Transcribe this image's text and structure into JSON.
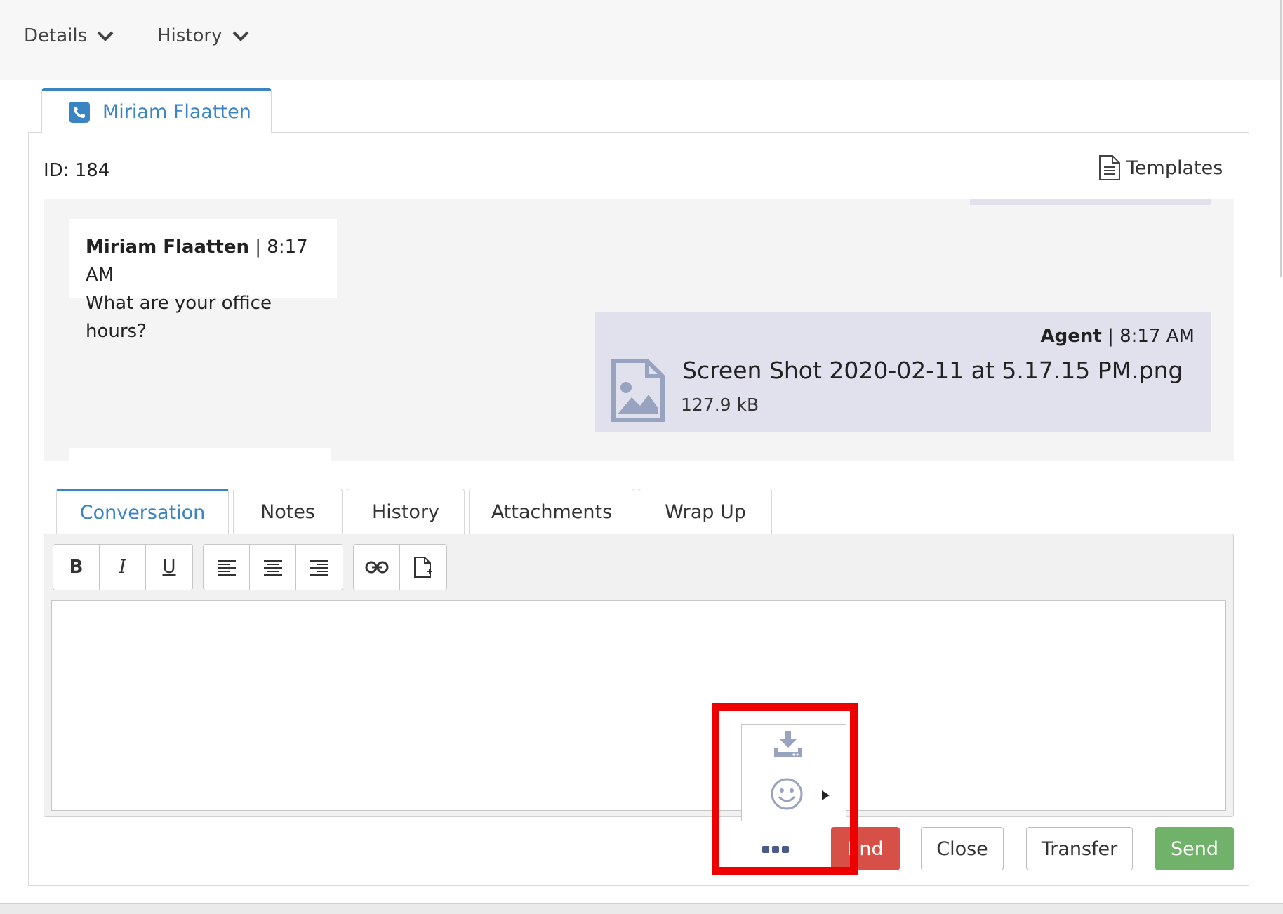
{
  "top_nav": {
    "details_label": "Details",
    "history_label": "History"
  },
  "conversation_tab": {
    "name": "Miriam Flaatten",
    "icon": "phone-icon"
  },
  "panel": {
    "id_label": "ID: 184",
    "templates_label": "Templates"
  },
  "messages": [
    {
      "sender": "Miriam Flaatten",
      "separator": "|",
      "time": "8:17 AM",
      "text": "What are your office hours?"
    },
    {
      "sender": "Agent",
      "separator": "|",
      "time": "8:17 AM",
      "attachment": {
        "file_name": "Screen Shot 2020-02-11 at 5.17.15 PM.png",
        "file_size": "127.9 kB",
        "icon": "image-file-icon"
      }
    }
  ],
  "tabs": [
    {
      "label": "Conversation",
      "active": true
    },
    {
      "label": "Notes",
      "active": false
    },
    {
      "label": "History",
      "active": false
    },
    {
      "label": "Attachments",
      "active": false
    },
    {
      "label": "Wrap Up",
      "active": false
    }
  ],
  "toolbar": {
    "bold": "B",
    "italic": "I",
    "underline": "U"
  },
  "popup_menu": {
    "items": [
      "download-icon",
      "emoji-icon"
    ]
  },
  "actions": {
    "end_label": "End",
    "close_label": "Close",
    "transfer_label": "Transfer",
    "send_label": "Send"
  },
  "colors": {
    "accent": "#3a84c4",
    "end": "#d75047",
    "send": "#71b26a",
    "agent_bubble": "#e1e1ee",
    "highlight": "#ee0000"
  }
}
